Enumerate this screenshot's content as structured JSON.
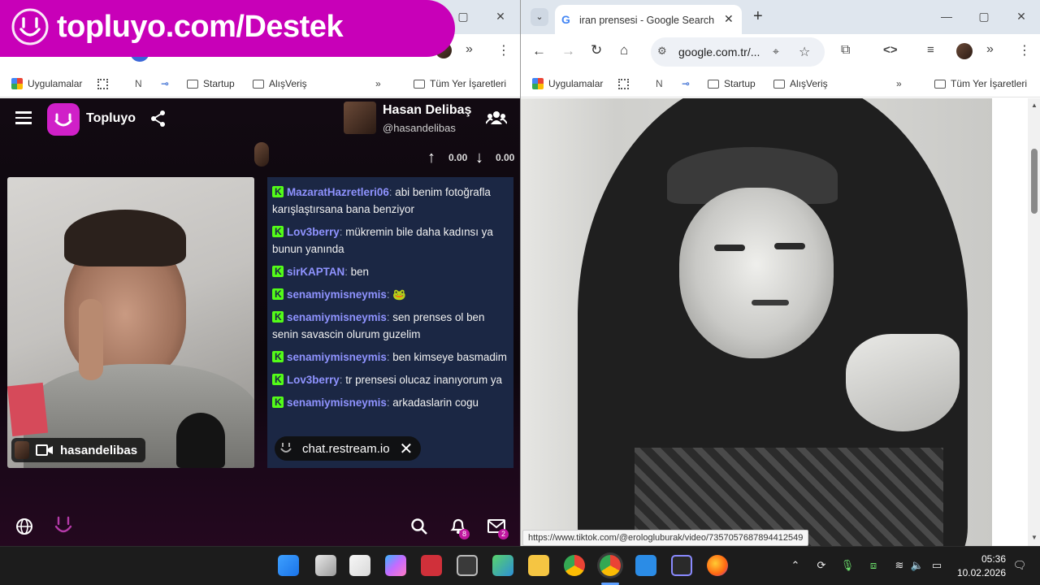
{
  "left_browser": {
    "bookmarks": [
      "Uygulamalar",
      "Startup",
      "AlışVeriş",
      "Tüm Yer İşaretleri"
    ]
  },
  "overlay_banner": {
    "text": "topluyo.com/Destek"
  },
  "topluyo": {
    "app_name": "Topluyo",
    "host": {
      "name": "Hasan Delibaş",
      "handle": "@hasandelibas"
    },
    "stats": {
      "up": "0.00",
      "down": "0.00"
    },
    "video_label": "hasandelibas",
    "chat": [
      {
        "user": "MazaratHazretleri06",
        "text": "abi benim fotoğrafla karışlaştırsana bana benziyor"
      },
      {
        "user": "Lov3berry",
        "text": "mükremin bile daha kadınsı ya bunun yanında"
      },
      {
        "user": "sirKAPTAN",
        "text": "ben"
      },
      {
        "user": "senamiymisneymis",
        "text": "🐸"
      },
      {
        "user": "senamiymisneymis",
        "text": "sen prenses ol ben senin savascin olurum guzelim"
      },
      {
        "user": "senamiymisneymis",
        "text": "ben kimseye basmadim"
      },
      {
        "user": "Lov3berry",
        "text": "tr prensesi olucaz inanıyorum ya"
      },
      {
        "user": "senamiymisneymis",
        "text": "arkadaslarin cogu"
      }
    ],
    "toast_text": "chat.restream.io",
    "notifications_count": "8",
    "messages_count": "2"
  },
  "right_browser": {
    "tab_title": "iran prensesi - Google Search",
    "address": "google.com.tr/...",
    "bookmarks": [
      "Uygulamalar",
      "Startup",
      "AlışVeriş",
      "Tüm Yer İşaretleri"
    ],
    "status_url": "https://www.tiktok.com/@erologluburak/video/7357057687894412549"
  },
  "taskbar": {
    "time": "05:36",
    "date": "10.02.2026"
  },
  "colors": {
    "topluyo_magenta": "#c800b8",
    "chat_bg": "#1b2744",
    "chat_user": "#8f93ff",
    "kick_green": "#53fc18"
  }
}
